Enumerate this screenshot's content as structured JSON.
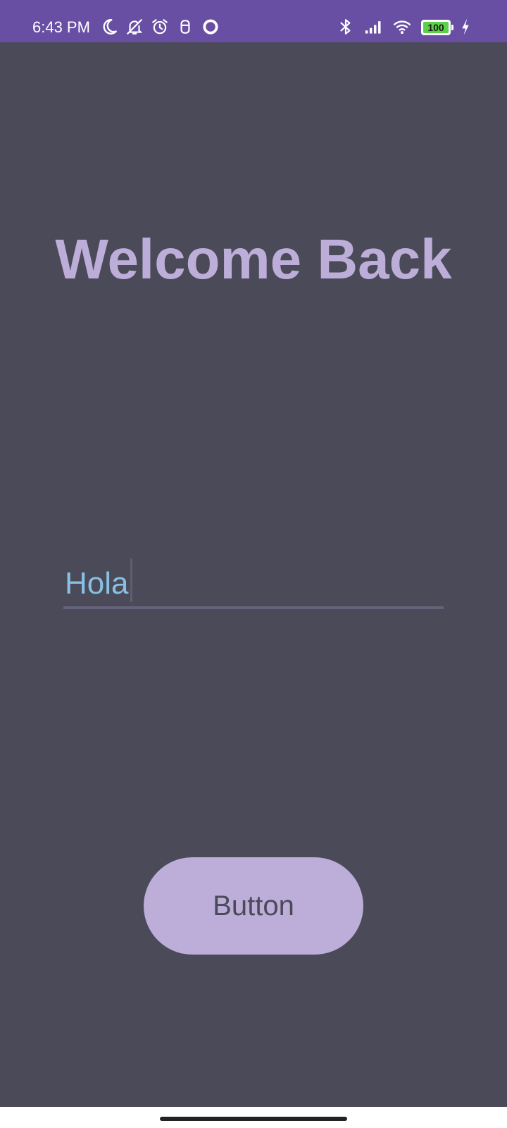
{
  "status_bar": {
    "time": "6:43 PM",
    "battery_level": "100",
    "background_color": "#684fa3",
    "left_icons": [
      "moon-icon",
      "notifications-off-icon",
      "alarm-icon",
      "sim-icon",
      "circle-icon"
    ],
    "right_icons": [
      "bluetooth-icon",
      "signal-icon",
      "wifi-icon",
      "battery-icon",
      "charging-icon"
    ]
  },
  "main": {
    "title": "Welcome Back",
    "input": {
      "value": "Hola"
    },
    "button_label": "Button"
  },
  "colors": {
    "background": "#4b4a59",
    "accent": "#bcaed8",
    "input_text": "#86c1e4",
    "battery_fill": "#5bd04a"
  }
}
